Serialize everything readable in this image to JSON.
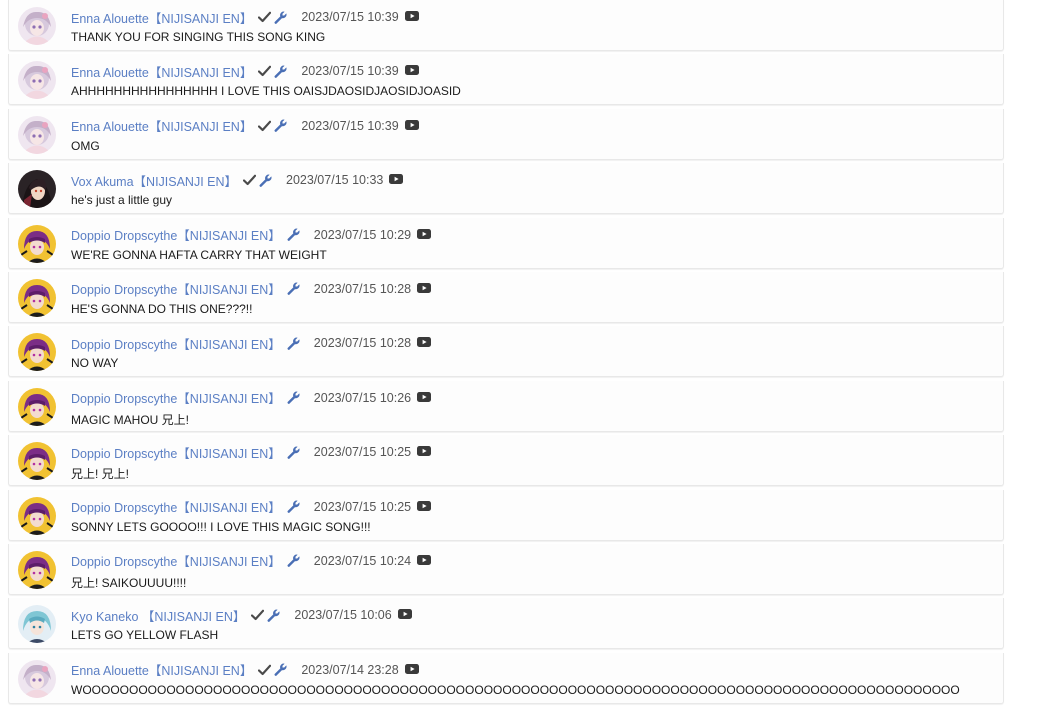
{
  "messages": [
    {
      "avatar": "enna",
      "author": "Enna Alouette【NIJISANJI EN】",
      "verified": true,
      "moderator": true,
      "time": "2023/07/15 10:39",
      "text": "THANK YOU FOR SINGING THIS SONG KING"
    },
    {
      "avatar": "enna",
      "author": "Enna Alouette【NIJISANJI EN】",
      "verified": true,
      "moderator": true,
      "time": "2023/07/15 10:39",
      "text": "AHHHHHHHHHHHHHHHH I LOVE THIS OAISJDAOSIDJAOSIDJOASID"
    },
    {
      "avatar": "enna",
      "author": "Enna Alouette【NIJISANJI EN】",
      "verified": true,
      "moderator": true,
      "time": "2023/07/15 10:39",
      "text": "OMG"
    },
    {
      "avatar": "vox",
      "author": "Vox Akuma【NIJISANJI EN】",
      "verified": true,
      "moderator": true,
      "time": "2023/07/15 10:33",
      "text": "he's just a little guy"
    },
    {
      "avatar": "doppio",
      "author": "Doppio Dropscythe【NIJISANJI EN】",
      "verified": false,
      "moderator": true,
      "time": "2023/07/15 10:29",
      "text": "WE'RE GONNA HAFTA CARRY THAT WEIGHT"
    },
    {
      "avatar": "doppio",
      "author": "Doppio Dropscythe【NIJISANJI EN】",
      "verified": false,
      "moderator": true,
      "time": "2023/07/15 10:28",
      "text": "HE'S GONNA DO THIS ONE???!!"
    },
    {
      "avatar": "doppio",
      "author": "Doppio Dropscythe【NIJISANJI EN】",
      "verified": false,
      "moderator": true,
      "time": "2023/07/15 10:28",
      "text": "NO WAY"
    },
    {
      "avatar": "doppio",
      "author": "Doppio Dropscythe【NIJISANJI EN】",
      "verified": false,
      "moderator": true,
      "time": "2023/07/15 10:26",
      "text": "MAGIC MAHOU 兄上!"
    },
    {
      "avatar": "doppio",
      "author": "Doppio Dropscythe【NIJISANJI EN】",
      "verified": false,
      "moderator": true,
      "time": "2023/07/15 10:25",
      "text": "兄上! 兄上!"
    },
    {
      "avatar": "doppio",
      "author": "Doppio Dropscythe【NIJISANJI EN】",
      "verified": false,
      "moderator": true,
      "time": "2023/07/15 10:25",
      "text": "SONNY LETS GOOOO!!! I LOVE THIS MAGIC SONG!!!"
    },
    {
      "avatar": "doppio",
      "author": "Doppio Dropscythe【NIJISANJI EN】",
      "verified": false,
      "moderator": true,
      "time": "2023/07/15 10:24",
      "text": "兄上! SAIKOUUUU!!!!"
    },
    {
      "avatar": "kyo",
      "author": "Kyo Kaneko 【NIJISANJI EN】",
      "verified": true,
      "moderator": true,
      "time": "2023/07/15 10:06",
      "text": "LETS GO YELLOW FLASH"
    },
    {
      "avatar": "enna",
      "author": "Enna Alouette【NIJISANJI EN】",
      "verified": true,
      "moderator": true,
      "time": "2023/07/14 23:28",
      "text": "WOOOOOOOOOOOOOOOOOOOOOOOOOOOOOOOOOOOOOOOOOOOOOOOOOOOOOOOOOOOOOOOOOOOOOOOOOOOOOOOOOOOOOOOOOOOOOO"
    }
  ],
  "colors": {
    "author": "#5b7fc4",
    "badge": "#4a6fb5",
    "timestamp": "#555555",
    "text": "#1a1a1a",
    "youtube_icon": "#3a3a3a"
  }
}
